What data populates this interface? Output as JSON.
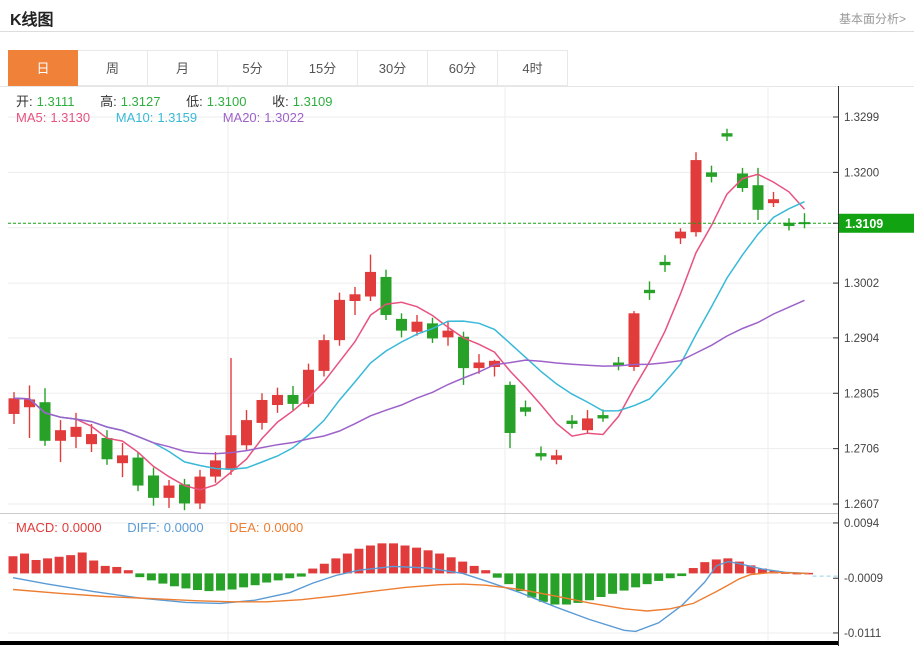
{
  "header": {
    "title": "K线图",
    "link": "基本面分析>"
  },
  "tabs": [
    {
      "label": "日",
      "active": true
    },
    {
      "label": "周",
      "active": false
    },
    {
      "label": "月",
      "active": false
    },
    {
      "label": "5分",
      "active": false
    },
    {
      "label": "15分",
      "active": false
    },
    {
      "label": "30分",
      "active": false
    },
    {
      "label": "60分",
      "active": false
    },
    {
      "label": "4时",
      "active": false
    }
  ],
  "ohlc": {
    "open_label": "开:",
    "open_value": "1.3111",
    "high_label": "高:",
    "high_value": "1.3127",
    "low_label": "低:",
    "low_value": "1.3100",
    "close_label": "收:",
    "close_value": "1.3109"
  },
  "ma": {
    "ma5_label": "MA5:",
    "ma5_value": "1.3130",
    "ma10_label": "MA10:",
    "ma10_value": "1.3159",
    "ma20_label": "MA20:",
    "ma20_value": "1.3022"
  },
  "macd_legend": {
    "macd_label": "MACD:",
    "macd_value": "0.0000",
    "diff_label": "DIFF:",
    "diff_value": "0.0000",
    "dea_label": "DEA:",
    "dea_value": "0.0000"
  },
  "colors": {
    "up": "#e23b3b",
    "down": "#27a127",
    "ma5": "#e8527f",
    "ma10": "#38b9d8",
    "ma20": "#9d62c9",
    "diff": "#5b9bd5",
    "dea": "#ed7d31",
    "current_price": "#11a311",
    "tab_active": "#f08138",
    "grid": "#ededed",
    "axis": "#333333",
    "ohlc_value": "#2fae3f"
  },
  "chart_data": {
    "type": "candlestick",
    "price_axis": {
      "ticks": [
        {
          "label": "1.3299",
          "value": 1.3299
        },
        {
          "label": "1.3200",
          "value": 1.32
        },
        {
          "label": "1.3109",
          "value": 1.3109,
          "current": true
        },
        {
          "label": "1.3002",
          "value": 1.3002
        },
        {
          "label": "1.2904",
          "value": 1.2904
        },
        {
          "label": "1.2805",
          "value": 1.2805
        },
        {
          "label": "1.2706",
          "value": 1.2706
        },
        {
          "label": "1.2607",
          "value": 1.2607
        }
      ],
      "grid_extra": [
        1.3101
      ],
      "current": 1.3109,
      "current_label": "1.3109"
    },
    "candles": [
      [
        1.2768,
        1.2807,
        1.275,
        1.2796
      ],
      [
        1.278,
        1.2819,
        1.2725,
        1.2794
      ],
      [
        1.2789,
        1.2814,
        1.2711,
        1.272
      ],
      [
        1.272,
        1.2757,
        1.2682,
        1.2739
      ],
      [
        1.2727,
        1.277,
        1.2707,
        1.2745
      ],
      [
        1.2714,
        1.275,
        1.27,
        1.2732
      ],
      [
        1.2725,
        1.2739,
        1.2677,
        1.2687
      ],
      [
        1.268,
        1.2716,
        1.2655,
        1.2694
      ],
      [
        1.269,
        1.27,
        1.263,
        1.264
      ],
      [
        1.2658,
        1.2672,
        1.2604,
        1.2618
      ],
      [
        1.2618,
        1.265,
        1.26,
        1.264
      ],
      [
        1.2642,
        1.2652,
        1.2596,
        1.2608
      ],
      [
        1.2608,
        1.2668,
        1.2598,
        1.2656
      ],
      [
        1.2656,
        1.27,
        1.2645,
        1.2685
      ],
      [
        1.2668,
        1.2868,
        1.2659,
        1.273
      ],
      [
        1.2712,
        1.2775,
        1.2703,
        1.2757
      ],
      [
        1.2752,
        1.2805,
        1.274,
        1.2793
      ],
      [
        1.2784,
        1.2815,
        1.277,
        1.2802
      ],
      [
        1.2802,
        1.2818,
        1.2775,
        1.2786
      ],
      [
        1.2786,
        1.2858,
        1.278,
        1.2847
      ],
      [
        1.2845,
        1.291,
        1.2835,
        1.29
      ],
      [
        1.29,
        1.2985,
        1.289,
        1.2972
      ],
      [
        1.297,
        1.2995,
        1.2945,
        1.2982
      ],
      [
        1.2978,
        1.3053,
        1.297,
        1.3022
      ],
      [
        1.3013,
        1.3026,
        1.2936,
        1.2945
      ],
      [
        1.2938,
        1.2948,
        1.2905,
        1.2917
      ],
      [
        1.2915,
        1.2945,
        1.2908,
        1.2933
      ],
      [
        1.293,
        1.294,
        1.2895,
        1.2903
      ],
      [
        1.2905,
        1.2933,
        1.289,
        1.2917
      ],
      [
        1.2906,
        1.2915,
        1.282,
        1.285
      ],
      [
        1.285,
        1.2875,
        1.284,
        1.286
      ],
      [
        1.2852,
        1.2865,
        1.2835,
        1.2863
      ],
      [
        1.282,
        1.2826,
        1.2707,
        1.2734
      ],
      [
        1.278,
        1.2792,
        1.2764,
        1.2772
      ],
      [
        1.2698,
        1.271,
        1.2685,
        1.2692
      ],
      [
        1.2686,
        1.2704,
        1.2678,
        1.2694
      ],
      [
        1.2756,
        1.2766,
        1.2742,
        1.275
      ],
      [
        1.2739,
        1.2775,
        1.2732,
        1.276
      ],
      [
        1.2766,
        1.2776,
        1.2754,
        1.276
      ],
      [
        1.286,
        1.287,
        1.2846,
        1.2854
      ],
      [
        1.2852,
        1.2952,
        1.2845,
        1.2948
      ],
      [
        1.299,
        1.3005,
        1.2972,
        1.2984
      ],
      [
        1.304,
        1.3052,
        1.3022,
        1.3034
      ],
      [
        1.3082,
        1.31,
        1.3072,
        1.3094
      ],
      [
        1.3093,
        1.3236,
        1.3085,
        1.3222
      ],
      [
        1.32,
        1.3212,
        1.3182,
        1.3192
      ],
      [
        1.327,
        1.3278,
        1.3256,
        1.3264
      ],
      [
        1.3198,
        1.3208,
        1.3165,
        1.3172
      ],
      [
        1.3177,
        1.3208,
        1.3115,
        1.3133
      ],
      [
        1.3145,
        1.3165,
        1.3138,
        1.3152
      ],
      [
        1.311,
        1.3118,
        1.3096,
        1.3104
      ],
      [
        1.3111,
        1.3127,
        1.31,
        1.3109
      ]
    ],
    "ma_windows": [
      5,
      10,
      20
    ],
    "macd": {
      "axis": [
        {
          "label": "0.0094",
          "value": 0.0094,
          "grid": true
        },
        {
          "label": "-0.0009",
          "value": -0.0009,
          "grid": false
        },
        {
          "label": "-0.0111",
          "value": -0.0111,
          "grid": true
        }
      ],
      "hist": [
        0.0032,
        0.0037,
        0.0025,
        0.0028,
        0.0031,
        0.0034,
        0.0039,
        0.0024,
        0.0014,
        0.0012,
        0.0006,
        -0.0007,
        -0.0013,
        -0.0019,
        -0.0024,
        -0.0028,
        -0.0031,
        -0.0033,
        -0.0032,
        -0.003,
        -0.0026,
        -0.0022,
        -0.0017,
        -0.0013,
        -0.0009,
        -0.0006,
        0.0009,
        0.0018,
        0.0028,
        0.0037,
        0.0046,
        0.0052,
        0.0056,
        0.0056,
        0.0052,
        0.0048,
        0.0043,
        0.0037,
        0.003,
        0.0022,
        0.0014,
        0.0006,
        -0.0008,
        -0.002,
        -0.0033,
        -0.0045,
        -0.0053,
        -0.0058,
        -0.0058,
        -0.0055,
        -0.005,
        -0.0044,
        -0.0038,
        -0.0032,
        -0.0026,
        -0.002,
        -0.0014,
        -0.0009,
        -0.0005,
        0.001,
        0.0021,
        0.0026,
        0.0028,
        0.0022,
        0.0015,
        0.0009,
        0.0005,
        0.0002,
        0.0001,
        0.0001
      ],
      "diff": [
        [
          0,
          -0.0008
        ],
        [
          3,
          -0.002
        ],
        [
          7,
          -0.0034
        ],
        [
          11,
          -0.0046
        ],
        [
          15,
          -0.0054
        ],
        [
          18,
          -0.0056
        ],
        [
          21,
          -0.005
        ],
        [
          24,
          -0.0036
        ],
        [
          26,
          -0.0018
        ],
        [
          28,
          -0.0004
        ],
        [
          30,
          0.0006
        ],
        [
          33,
          0.0013
        ],
        [
          36,
          0.001
        ],
        [
          39,
          0.0
        ],
        [
          41,
          -0.0014
        ],
        [
          44,
          -0.0036
        ],
        [
          47,
          -0.0062
        ],
        [
          50,
          -0.0086
        ],
        [
          53,
          -0.0106
        ],
        [
          54,
          -0.0108
        ],
        [
          56,
          -0.0092
        ],
        [
          58,
          -0.006
        ],
        [
          60,
          -0.0016
        ],
        [
          61,
          0.0014
        ],
        [
          62,
          0.0022
        ],
        [
          63,
          0.0018
        ],
        [
          65,
          0.0008
        ],
        [
          67,
          0.0002
        ],
        [
          69,
          0.0
        ]
      ],
      "dea": [
        [
          0,
          -0.003
        ],
        [
          4,
          -0.0037
        ],
        [
          8,
          -0.0043
        ],
        [
          12,
          -0.0047
        ],
        [
          16,
          -0.0051
        ],
        [
          19,
          -0.0053
        ],
        [
          22,
          -0.0053
        ],
        [
          25,
          -0.0049
        ],
        [
          28,
          -0.0042
        ],
        [
          31,
          -0.0034
        ],
        [
          34,
          -0.0026
        ],
        [
          37,
          -0.0021
        ],
        [
          39,
          -0.002
        ],
        [
          41,
          -0.0022
        ],
        [
          44,
          -0.003
        ],
        [
          47,
          -0.0042
        ],
        [
          50,
          -0.0055
        ],
        [
          53,
          -0.0066
        ],
        [
          55,
          -0.007
        ],
        [
          57,
          -0.0066
        ],
        [
          59,
          -0.0056
        ],
        [
          61,
          -0.0034
        ],
        [
          62,
          -0.0022
        ],
        [
          63,
          -0.001
        ],
        [
          64,
          -0.0002
        ],
        [
          66,
          0.0002
        ],
        [
          69,
          0.0
        ]
      ]
    }
  }
}
